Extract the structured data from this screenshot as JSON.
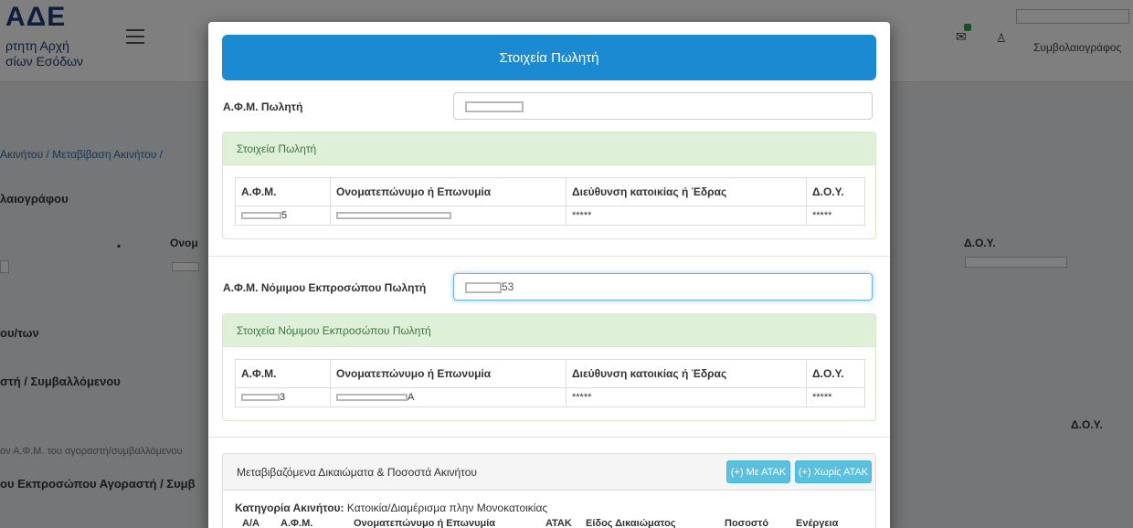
{
  "background": {
    "logo": "ΑΔΕ",
    "logo_sub_1": "ρτητη Αρχή",
    "logo_sub_2": "σίων Εσόδων",
    "role": "Συμβολαιογράφος",
    "breadcrumb": "Ακινήτου  /  Μεταβίβαση Ακινήτου  /",
    "section_1": "λαιογράφου",
    "col_onoma": "Ονομ",
    "col_doy": "Δ.Ο.Υ.",
    "section_2": "ου/των",
    "section_3": "στή / Συμβαλλόμενου",
    "col_doy_2": "Δ.Ο.Υ.",
    "hint": "ον Α.Φ.Μ. του αγοραστή/συμβαλλόμενου",
    "section_4": "ου Εκπροσώπου Αγοραστή / Συμβ"
  },
  "modal": {
    "title": "Στοιχεία Πωλητή",
    "seller_afm_label": "Α.Φ.Μ. Πωλητή",
    "seller_panel_title": "Στοιχεία Πωλητή",
    "table_headers": [
      "Α.Φ.Μ.",
      "Ονοματεπώνυμο ή Επωνυμία",
      "Διεύθυνση κατοικίας ή Έδρας",
      "Δ.Ο.Υ."
    ],
    "seller_row": {
      "afm_suffix": "5",
      "address": "*****",
      "doy": "*****"
    },
    "rep_afm_label": "Α.Φ.Μ. Νόμιμου Εκπροσώπου Πωλητή",
    "rep_afm_suffix": "53",
    "rep_panel_title": "Στοιχεία Νόμιμου Εκπροσώπου Πωλητή",
    "rep_row": {
      "afm_suffix": "3",
      "name_suffix": "Α",
      "address": "*****",
      "doy": "*****"
    },
    "rights_panel_title": "Μεταβιβαζόμενα Δικαιώματα & Ποσοστά Ακινήτου",
    "btn_with_atak": "(+) Με ΑΤΑΚ",
    "btn_without_atak": "(+) Χωρίς ΑΤΑΚ",
    "category_label": "Κατηγορία Ακινήτου:",
    "category_value": "Κατοικία/Διαμέρισμα πλην Μονοκατοικίας",
    "rights_cols": [
      "Α/Α",
      "Α.Φ.Μ.",
      "Ονοματεπώνυμο ή Επωνυμία",
      "ΑΤΑΚ",
      "Είδος Δικαιώματος",
      "Ποσοστό",
      "Ενέργεια"
    ]
  }
}
